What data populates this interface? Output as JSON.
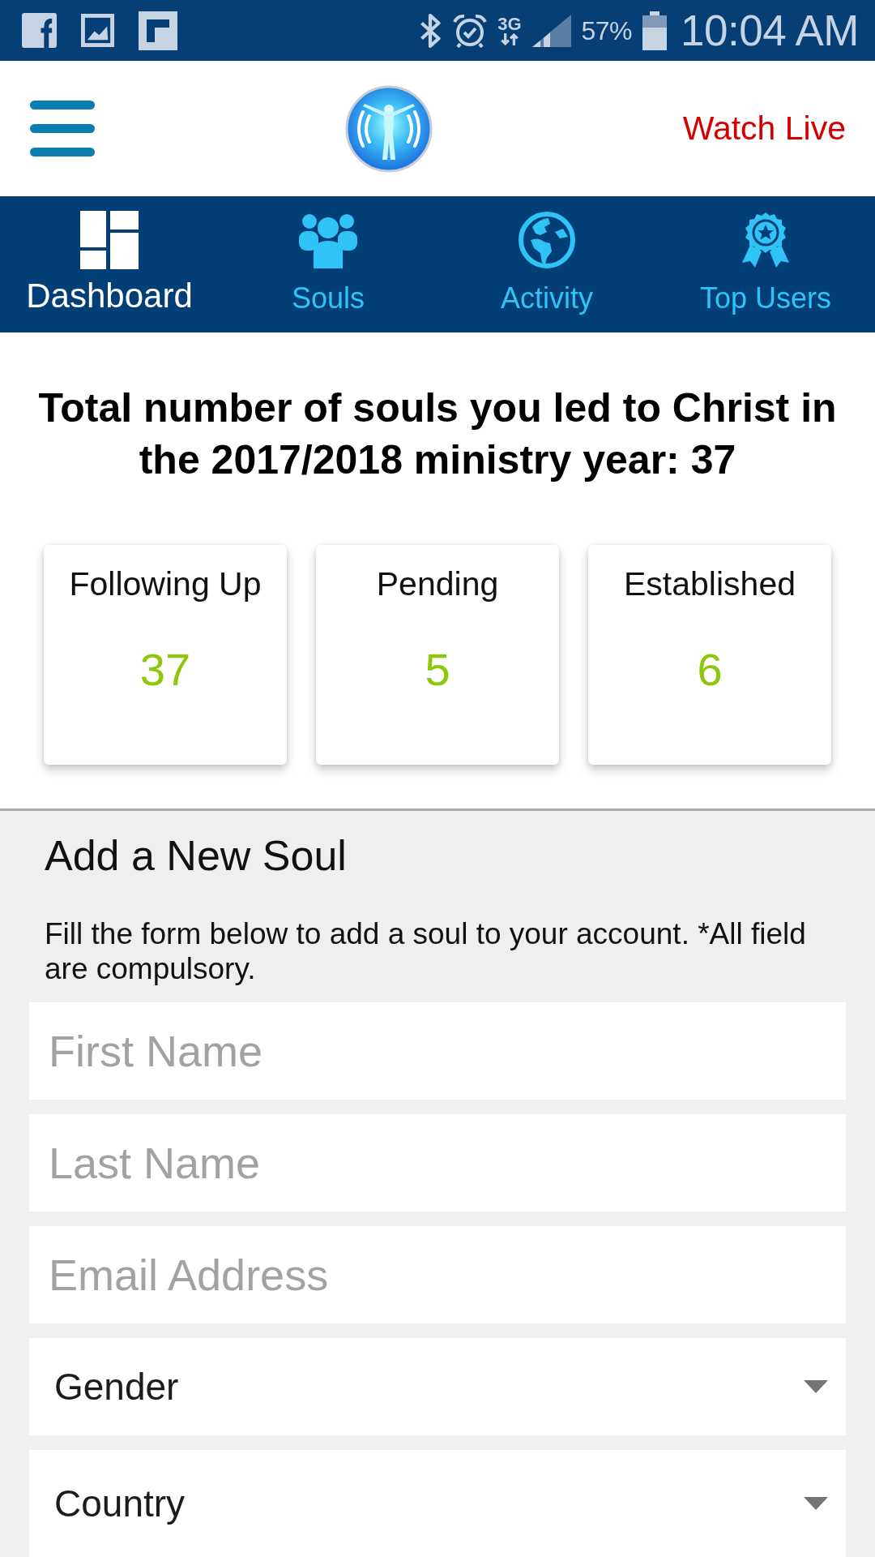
{
  "status_bar": {
    "network": "3G",
    "battery": "57%",
    "time": "10:04 AM"
  },
  "header": {
    "watch_live": "Watch Live"
  },
  "tabs": [
    {
      "label": "Dashboard",
      "selected": true
    },
    {
      "label": "Souls",
      "selected": false
    },
    {
      "label": "Activity",
      "selected": false
    },
    {
      "label": "Top Users",
      "selected": false
    }
  ],
  "summary": "Total number of souls you led to Christ in the 2017/2018 ministry year: 37",
  "stats": [
    {
      "label": "Following Up",
      "value": "37"
    },
    {
      "label": "Pending",
      "value": "5"
    },
    {
      "label": "Established",
      "value": "6"
    }
  ],
  "form": {
    "title": "Add a New Soul",
    "description": "Fill the form below to add a soul to your account. *All field are compulsory.",
    "fields": [
      {
        "kind": "input",
        "placeholder": "First Name"
      },
      {
        "kind": "input",
        "placeholder": "Last Name"
      },
      {
        "kind": "input",
        "placeholder": "Email Address"
      },
      {
        "kind": "select",
        "value": "Gender"
      },
      {
        "kind": "select",
        "value": "Country"
      }
    ]
  }
}
